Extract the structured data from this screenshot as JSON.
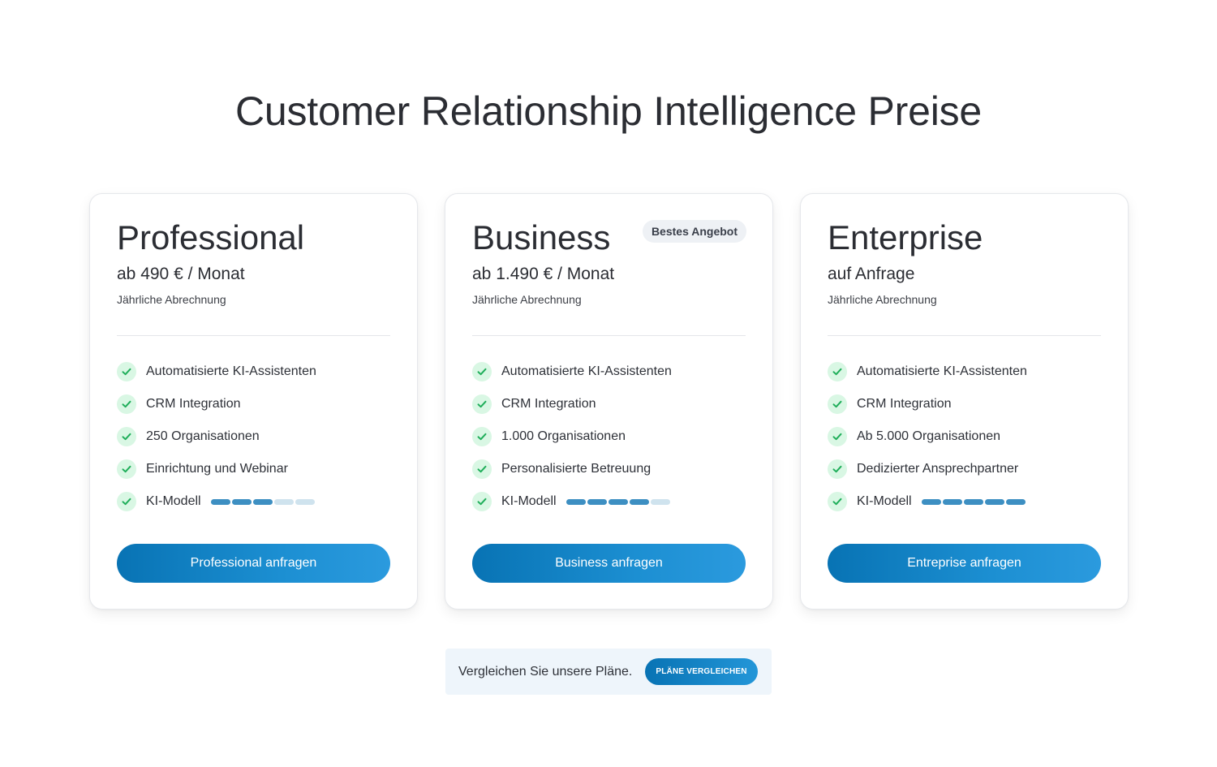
{
  "page": {
    "title": "Customer Relationship Intelligence Preise"
  },
  "colors": {
    "accent": "#0873b4",
    "accent_light": "#2b9ade",
    "check_bg": "#d9f7e4",
    "check_mark": "#1fae5a",
    "level_on": "#3d8fc2",
    "level_off": "#cfe3ee",
    "badge_bg": "#eef1f5",
    "compare_bg": "#eef5fb"
  },
  "plans": [
    {
      "name": "Professional",
      "badge": "",
      "price": "ab 490 € / Monat",
      "billing": "Jährliche Abrechnung",
      "features": [
        "Automatisierte KI-Assistenten",
        "CRM Integration",
        "250 Organisationen",
        "Einrichtung und Webinar"
      ],
      "model_label": "KI-Modell",
      "model_level": 3,
      "model_max": 5,
      "cta": "Professional anfragen"
    },
    {
      "name": "Business",
      "badge": "Bestes Angebot",
      "price": "ab 1.490 € / Monat",
      "billing": "Jährliche Abrechnung",
      "features": [
        "Automatisierte KI-Assistenten",
        "CRM Integration",
        "1.000 Organisationen",
        "Personalisierte Betreuung"
      ],
      "model_label": "KI-Modell",
      "model_level": 4,
      "model_max": 5,
      "cta": "Business anfragen"
    },
    {
      "name": "Enterprise",
      "badge": "",
      "price": "auf Anfrage",
      "billing": "Jährliche Abrechnung",
      "features": [
        "Automatisierte KI-Assistenten",
        "CRM Integration",
        "Ab 5.000 Organisationen",
        "Dedizierter Ansprechpartner"
      ],
      "model_label": "KI-Modell",
      "model_level": 5,
      "model_max": 5,
      "cta": "Entreprise anfragen"
    }
  ],
  "compare": {
    "text": "Vergleichen Sie unsere Pläne.",
    "button": "PLÄNE VERGLEICHEN"
  }
}
